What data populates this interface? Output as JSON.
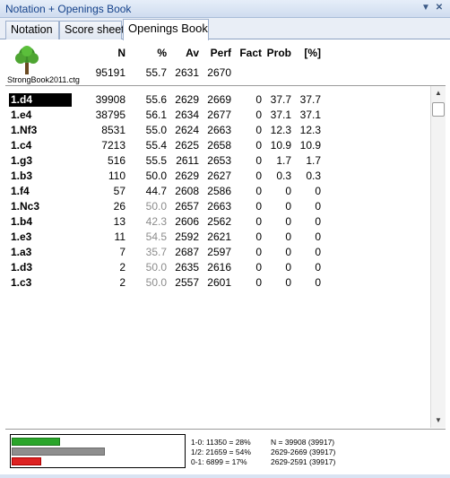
{
  "window": {
    "title": "Notation + Openings Book",
    "pin_icon": "pin-down-icon",
    "close_icon": "close-icon"
  },
  "tabs": [
    {
      "label": "Notation",
      "active": false
    },
    {
      "label": "Score sheet",
      "active": false
    },
    {
      "label": "Openings Book",
      "active": true
    }
  ],
  "book": {
    "name": "StrongBook2011.ctg",
    "icon": "tree-icon",
    "total": {
      "n": "95191",
      "pct": "55.7",
      "av": "2631",
      "perf": "2670"
    }
  },
  "columns": [
    "N",
    "%",
    "Av",
    "Perf",
    "Fact",
    "Prob",
    "[%]"
  ],
  "moves": [
    {
      "move": "1.d4",
      "n": "39908",
      "pct": "55.6",
      "av": "2629",
      "perf": "2669",
      "fact": "0",
      "prob": "37.7",
      "w": "37.7",
      "grey": false,
      "selected": true
    },
    {
      "move": "1.e4",
      "n": "38795",
      "pct": "56.1",
      "av": "2634",
      "perf": "2677",
      "fact": "0",
      "prob": "37.1",
      "w": "37.1",
      "grey": false,
      "selected": false
    },
    {
      "move": "1.Nf3",
      "n": "8531",
      "pct": "55.0",
      "av": "2624",
      "perf": "2663",
      "fact": "0",
      "prob": "12.3",
      "w": "12.3",
      "grey": false,
      "selected": false
    },
    {
      "move": "1.c4",
      "n": "7213",
      "pct": "55.4",
      "av": "2625",
      "perf": "2658",
      "fact": "0",
      "prob": "10.9",
      "w": "10.9",
      "grey": false,
      "selected": false
    },
    {
      "move": "1.g3",
      "n": "516",
      "pct": "55.5",
      "av": "2611",
      "perf": "2653",
      "fact": "0",
      "prob": "1.7",
      "w": "1.7",
      "grey": false,
      "selected": false
    },
    {
      "move": "1.b3",
      "n": "110",
      "pct": "50.0",
      "av": "2629",
      "perf": "2627",
      "fact": "0",
      "prob": "0.3",
      "w": "0.3",
      "grey": false,
      "selected": false
    },
    {
      "move": "1.f4",
      "n": "57",
      "pct": "44.7",
      "av": "2608",
      "perf": "2586",
      "fact": "0",
      "prob": "0",
      "w": "0",
      "grey": false,
      "selected": false
    },
    {
      "move": "1.Nc3",
      "n": "26",
      "pct": "50.0",
      "av": "2657",
      "perf": "2663",
      "fact": "0",
      "prob": "0",
      "w": "0",
      "grey": true,
      "selected": false
    },
    {
      "move": "1.b4",
      "n": "13",
      "pct": "42.3",
      "av": "2606",
      "perf": "2562",
      "fact": "0",
      "prob": "0",
      "w": "0",
      "grey": true,
      "selected": false
    },
    {
      "move": "1.e3",
      "n": "11",
      "pct": "54.5",
      "av": "2592",
      "perf": "2621",
      "fact": "0",
      "prob": "0",
      "w": "0",
      "grey": true,
      "selected": false
    },
    {
      "move": "1.a3",
      "n": "7",
      "pct": "35.7",
      "av": "2687",
      "perf": "2597",
      "fact": "0",
      "prob": "0",
      "w": "0",
      "grey": true,
      "selected": false
    },
    {
      "move": "1.d3",
      "n": "2",
      "pct": "50.0",
      "av": "2635",
      "perf": "2616",
      "fact": "0",
      "prob": "0",
      "w": "0",
      "grey": true,
      "selected": false
    },
    {
      "move": "1.c3",
      "n": "2",
      "pct": "50.0",
      "av": "2557",
      "perf": "2601",
      "fact": "0",
      "prob": "0",
      "w": "0",
      "grey": true,
      "selected": false
    }
  ],
  "results": {
    "win_fraction": 0.28,
    "draw_fraction": 0.54,
    "loss_fraction": 0.17,
    "colors": {
      "win": "#2aa52a",
      "draw": "#8e8e8e",
      "loss": "#dd2222"
    },
    "win_text": "1-0: 11350 = 28%",
    "draw_text": "1/2: 21659 = 54%",
    "loss_text": "0-1: 6899 = 17%",
    "n_text": "N = 39908 (39917)",
    "range1_text": "2629-2669 (39917)",
    "range2_text": "2629-2591 (39917)"
  }
}
